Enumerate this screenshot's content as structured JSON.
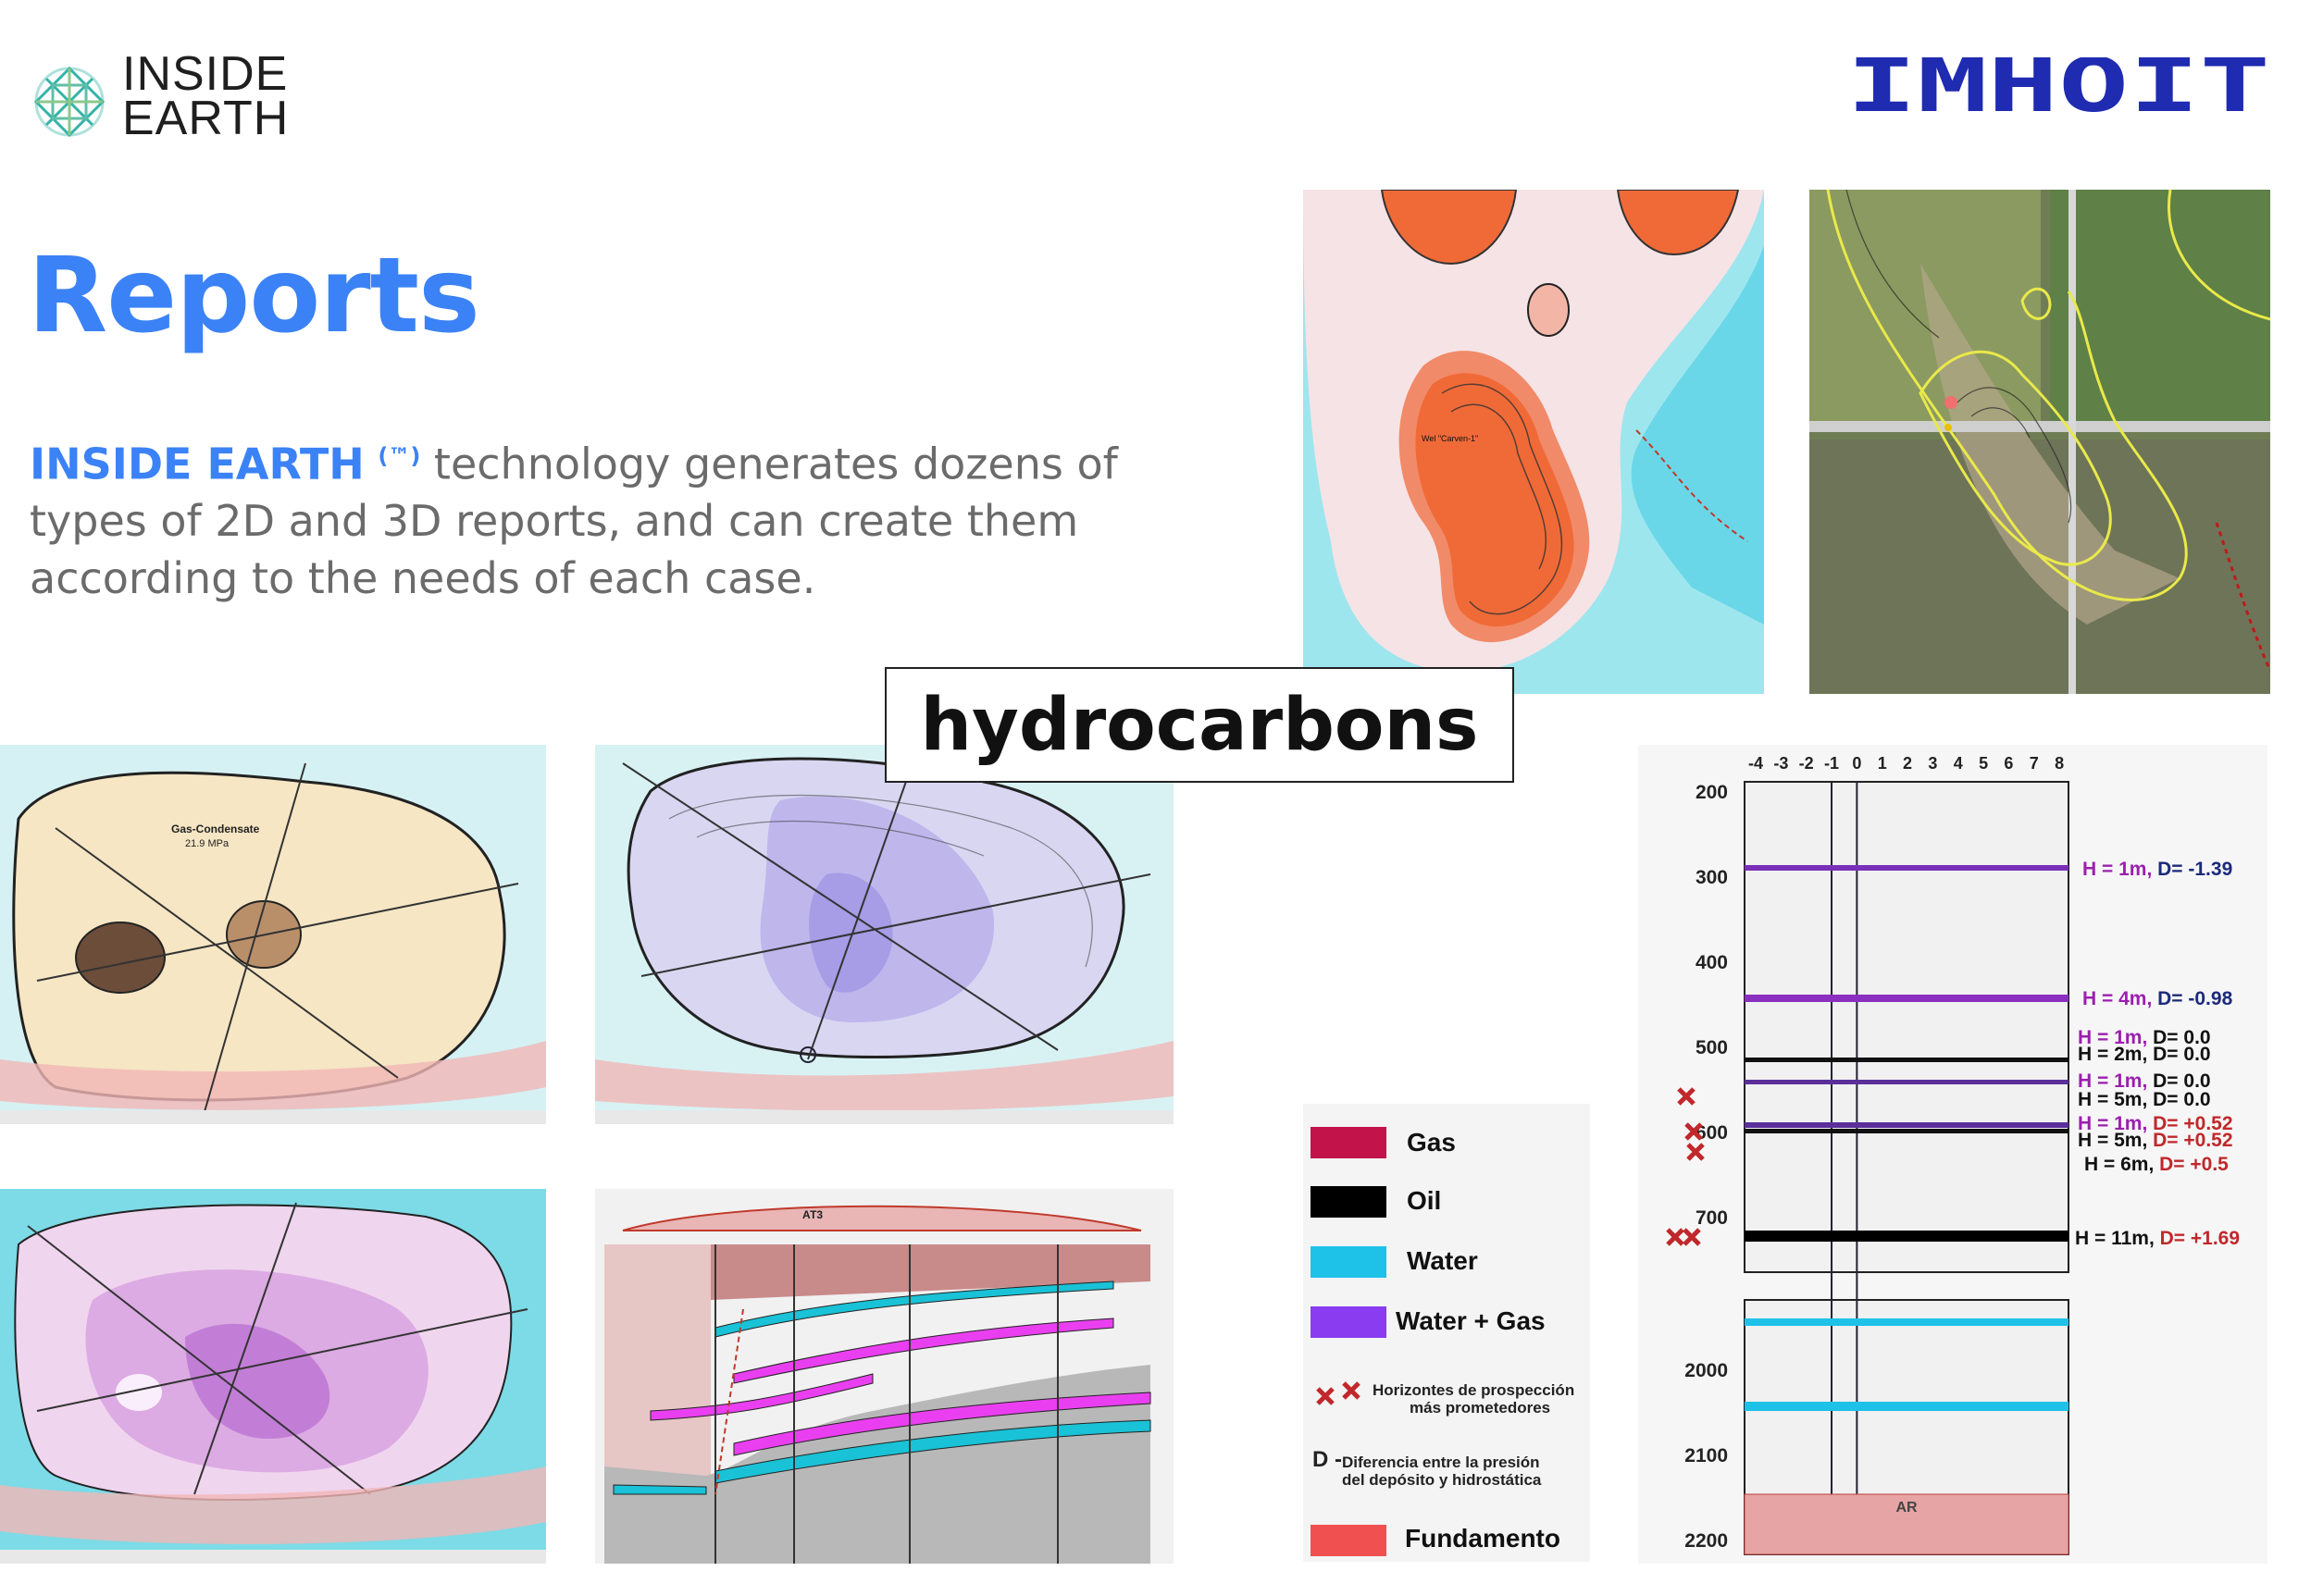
{
  "header": {
    "logo_line1": "INSIDE",
    "logo_line2": "EARTH",
    "brand_right": "IMHOIT"
  },
  "title": "Reports",
  "intro": {
    "highlight": "INSIDE EARTH",
    "tm": "(™)",
    "text": " technology generates dozens of types of 2D and 3D reports, and can create them according to the needs of each case."
  },
  "overlay_label": "hydrocarbons",
  "legend": {
    "items": [
      {
        "label": "Gas",
        "color": "#c2134b"
      },
      {
        "label": "Oil",
        "color": "#000000"
      },
      {
        "label": "Water",
        "color": "#1ec1e8"
      },
      {
        "label": "Water + Gas",
        "color": "#8a3cf0"
      }
    ],
    "horizon_note_line1": "Horizontes de prospección",
    "horizon_note_line2": "más prometedores",
    "d_prefix": "D -",
    "d_note_line1": "Diferencia entre la presión",
    "d_note_line2": "del depósito y hidrostática",
    "basement": {
      "label": "Fundamento",
      "color": "#f05050"
    }
  },
  "strat_column": {
    "x_ticks": [
      "-4",
      "-3",
      "-2",
      "-1",
      "0",
      "1",
      "2",
      "3",
      "4",
      "5",
      "6",
      "7",
      "8"
    ],
    "depths_upper": [
      "200",
      "300",
      "400",
      "500",
      "600",
      "700"
    ],
    "depths_lower": [
      "2000",
      "2100",
      "2200"
    ],
    "basement_label": "AR",
    "layers": [
      {
        "h": "H = 1m",
        "d": "D= -1.39"
      },
      {
        "h": "H = 4m",
        "d": "D= -0.98"
      },
      {
        "h": "H = 1m",
        "d": "D= 0.0"
      },
      {
        "h": "H = 2m",
        "d": "D= 0.0"
      },
      {
        "h": "H = 1m",
        "d": "D= 0.0"
      },
      {
        "h": "H = 5m",
        "d": "D= 0.0"
      },
      {
        "h": "H = 1m",
        "d": "D= +0.52"
      },
      {
        "h": "H = 5m",
        "d": "D= +0.52"
      },
      {
        "h": "H = 6m",
        "d": "D= +0.5"
      },
      {
        "h": "H = 11m",
        "d": "D= +1.69"
      }
    ]
  },
  "map_labels": {
    "well": "Wel \"Carven-1\"",
    "gas_cond": "Gas-Condensate",
    "pressure": "21.9 MPa",
    "at3": "АТ3"
  }
}
